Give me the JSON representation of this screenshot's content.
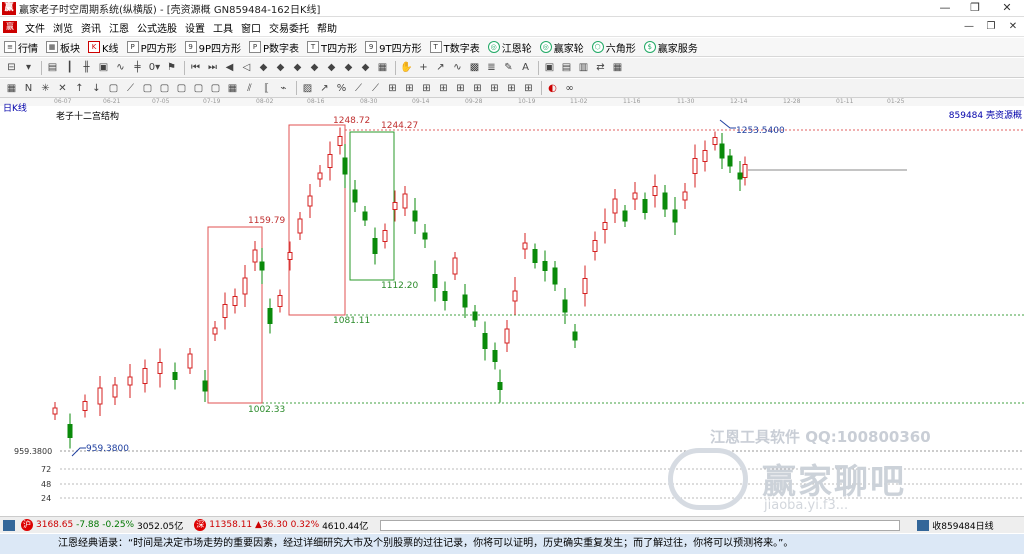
{
  "window": {
    "title": "赢家老子时空周期系统(纵横版) - [壳资源概  GN859484-162日K线]",
    "buttons": [
      "—",
      "❐",
      "✕"
    ]
  },
  "menu": {
    "items": [
      "文件",
      "浏览",
      "资讯",
      "江恩",
      "公式选股",
      "设置",
      "工具",
      "窗口",
      "交易委托",
      "帮助"
    ],
    "right_buttons": [
      "—",
      "❐",
      "✕"
    ]
  },
  "toolbar1": {
    "items": [
      {
        "icon": "list-icon",
        "label": "行情"
      },
      {
        "icon": "grid-icon",
        "label": "板块"
      },
      {
        "icon": "kline-icon",
        "label": "K线"
      },
      {
        "icon": "p-square-icon",
        "label": "P四方形"
      },
      {
        "icon": "9p-square-icon",
        "label": "9P四方形"
      },
      {
        "icon": "p-number-table-icon",
        "label": "P数字表"
      },
      {
        "icon": "t-square-icon",
        "label": "T四方形"
      },
      {
        "icon": "9t-square-icon",
        "label": "9T四方形"
      },
      {
        "icon": "t-number-table-icon",
        "label": "T数字表"
      },
      {
        "icon": "gann-wheel-icon",
        "label": "江恩轮"
      },
      {
        "icon": "winner-wheel-icon",
        "label": "赢家轮"
      },
      {
        "icon": "hexagon-icon",
        "label": "六角形"
      },
      {
        "icon": "dollar-icon",
        "label": "赢家服务"
      }
    ]
  },
  "chart": {
    "period_label": "日K线",
    "title": "老子十二宫结构",
    "code_label": "859484 壳资源概",
    "date_ticks": [
      "06-07",
      "06-21",
      "07-05",
      "07-19",
      "08-02",
      "08-16",
      "08-30",
      "09-14",
      "09-28",
      "10-19",
      "11-02",
      "11-16",
      "11-30",
      "12-14",
      "12-28",
      "01-11",
      "01-25"
    ],
    "price_axis_labels": [
      "959.3800",
      "72",
      "48",
      "24"
    ],
    "annotations": {
      "p1248": "1248.72",
      "p1244": "1244.27",
      "p1253": "1253.5400",
      "p1159": "1159.79",
      "p1112": "1112.20",
      "p1081": "1081.11",
      "p1002": "1002.33",
      "p959": "959.3800"
    },
    "colors": {
      "up": "#d42020",
      "down": "#0a8a0a",
      "box_red": "#e05050",
      "box_green": "#2a9a2a"
    }
  },
  "chart_data": {
    "type": "candlestick",
    "title": "老子十二宫结构",
    "levels": {
      "low": 959.38,
      "high": 1253.54,
      "box_tops": [
        1159.79,
        1248.72,
        1244.27
      ],
      "box_bottoms": [
        1002.33,
        1081.11,
        1112.2
      ]
    },
    "x": [
      "06-07",
      "06-21",
      "07-05",
      "07-19",
      "08-02",
      "08-16",
      "08-30",
      "09-14",
      "09-28",
      "10-19",
      "11-02",
      "11-16",
      "11-30",
      "12-14"
    ],
    "close_approx": [
      990,
      1030,
      1040,
      1010,
      1130,
      1200,
      1200,
      1160,
      1060,
      1090,
      1160,
      1180,
      1210,
      1230
    ]
  },
  "statusbar": {
    "idx1_value": "3168.65",
    "idx1_change": "-7.88",
    "idx1_pct": "-0.25%",
    "idx1_amount": "3052.05亿",
    "idx2_value": "11358.11",
    "idx2_change": "▲36.30",
    "idx2_pct": "0.32%",
    "idx2_amount": "4610.44亿",
    "right_label": "收859484日线"
  },
  "quote": "江恩经典语录：“时间是决定市场走势的重要因素，经过详细研究大市及个别股票的过往记录，你将可以证明，历史确实重复发生；而了解过往，你将可以预测将来。”。",
  "watermark": {
    "line1": "江恩工具软件  QQ:100800360",
    "line2": "赢家聊吧",
    "line3": "jiaoba.yi.f3..."
  }
}
